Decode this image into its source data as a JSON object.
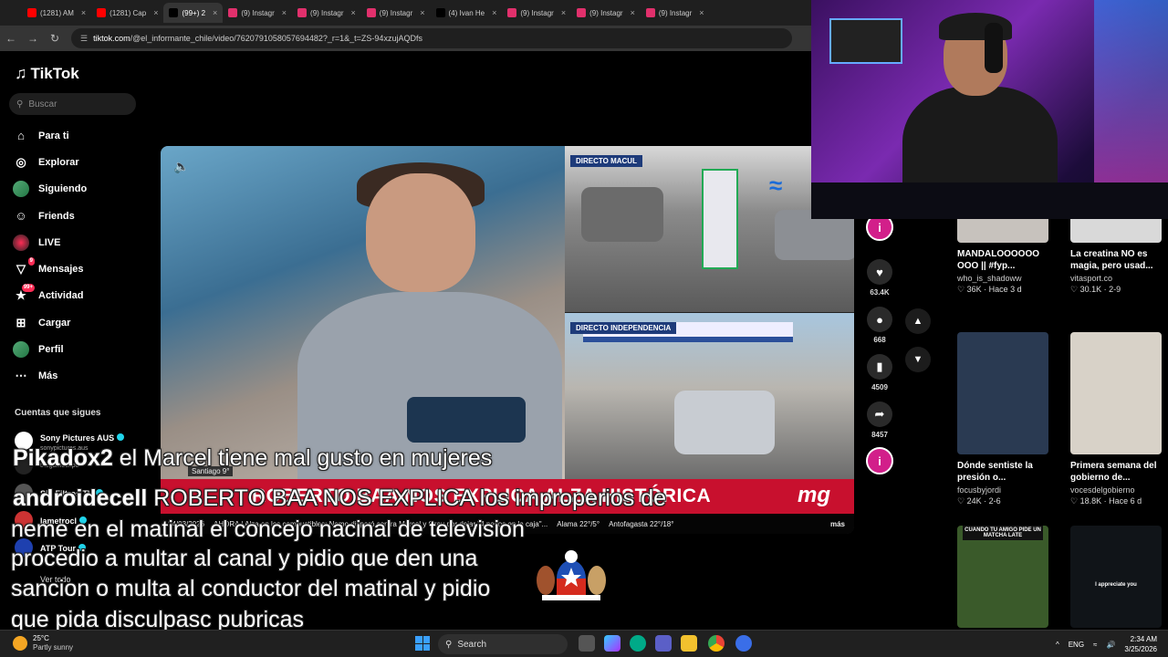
{
  "tabs": [
    {
      "label": "(1281) AM",
      "color": "#ff0000"
    },
    {
      "label": "(1281) Cap",
      "color": "#ff0000"
    },
    {
      "label": "(99+) 2",
      "color": "#000000"
    },
    {
      "label": "(9) Instagr",
      "color": "#e1306c"
    },
    {
      "label": "(9) Instagr",
      "color": "#e1306c"
    },
    {
      "label": "(9) Instagr",
      "color": "#e1306c"
    },
    {
      "label": "(4) Ivan He",
      "color": "#000000"
    },
    {
      "label": "(9) Instagr",
      "color": "#e1306c"
    },
    {
      "label": "(9) Instagr",
      "color": "#e1306c"
    },
    {
      "label": "(9) Instagr",
      "color": "#e1306c"
    }
  ],
  "address": {
    "host": "tiktok.com",
    "path": "/@el_informante_chile/video/7620791058057694482?_r=1&_t=ZS-94xzujAQDfs"
  },
  "sidebar": {
    "logo": "TikTok",
    "search_placeholder": "Buscar",
    "menu": [
      {
        "label": "Para ti",
        "icon": "home-icon"
      },
      {
        "label": "Explorar",
        "icon": "compass-icon"
      },
      {
        "label": "Siguiendo",
        "icon": "avatar-icon"
      },
      {
        "label": "Friends",
        "icon": "friends-icon"
      },
      {
        "label": "LIVE",
        "icon": "live-icon"
      },
      {
        "label": "Mensajes",
        "icon": "messages-icon",
        "badge": "9"
      },
      {
        "label": "Actividad",
        "icon": "activity-icon",
        "badge": "99+"
      },
      {
        "label": "Cargar",
        "icon": "upload-icon"
      },
      {
        "label": "Perfil",
        "icon": "profile-icon"
      },
      {
        "label": "Más",
        "icon": "more-icon"
      }
    ],
    "following_title": "Cuentas que sigues",
    "accounts": [
      {
        "name": "Sony Pictures AUS",
        "handle": "sonypictures.aus"
      },
      {
        "name": "",
        "handle": "thegameexpo"
      },
      {
        "name": "Sin Filtros TV",
        "handle": ""
      },
      {
        "name": "lametrocl",
        "handle": ""
      },
      {
        "name": "ATP Tour",
        "handle": ""
      }
    ],
    "see_all": "Ver todo"
  },
  "video": {
    "tag_top": "DIRECTO MACUL",
    "tag_bottom": "DIRECTO INDEPENDENCIA",
    "location": "Santiago 9°",
    "headline": "ROBERTO BAA NOS EXPLICA ALZA HISTÓRICA",
    "channel_logo": "mg",
    "ticker_date": "24/03/2026",
    "ticker_text": "AHORA | Alza en los combustibles: Nemo disparó contra Marcel y Grau por dejar \"4 pesos en la caja\"...",
    "ticker_weather_1": "Alama 22°/5°",
    "ticker_weather_2": "Antofagasta 22°/18°",
    "more": "más"
  },
  "actions": {
    "likes": "63.4K",
    "comments": "668",
    "saves": "4509",
    "shares": "8457"
  },
  "recommendations": [
    {
      "title": "MANDALOOOOOO OOO || #fyp...",
      "user": "who_is_shadoww",
      "meta": "36K · Hace 3 d",
      "color": "#c7c2bd"
    },
    {
      "title": "La creatina NO es magia, pero usad...",
      "user": "vitasport.co",
      "meta": "30.1K · 2-9",
      "color": "#d9d9d9"
    },
    {
      "title": "Dónde sentiste la presión o...",
      "user": "focusbyjordi",
      "meta": "24K · 2-6",
      "color": "#2a3a52"
    },
    {
      "title": "Primera semana del gobierno de...",
      "user": "vocesdelgobierno",
      "meta": "18.8K · Hace 6 d",
      "color": "#d8d2c8"
    },
    {
      "title": "",
      "user": "",
      "meta": "",
      "color": "#3a5a2a",
      "caption": "CUANDO TU AMIGO PIDE UN MATCHA LATE"
    },
    {
      "title": "",
      "user": "",
      "meta": "",
      "color": "#101418",
      "caption": "I appreciate you"
    }
  ],
  "chat": [
    {
      "user": "Pikadox2",
      "message": "el Marcel tiene mal gusto en mujeres"
    },
    {
      "user": "androidecell",
      "message": "ROBERTO BAA NOS EXPLICA los improperios de"
    },
    {
      "user": "",
      "message": "neme en el matinal el concejo nacinal de television"
    },
    {
      "user": "",
      "message": "procedio a multar al canal y pidio que den una"
    },
    {
      "user": "",
      "message": "sancion o multa al conductor del matinal y pidio"
    },
    {
      "user": "",
      "message": "que pida disculpasc pubricas"
    }
  ],
  "taskbar": {
    "temp": "25°C",
    "weather": "Partly sunny",
    "search": "Search",
    "lang": "ENG",
    "time": "2:34 AM",
    "date": "3/25/2026"
  }
}
